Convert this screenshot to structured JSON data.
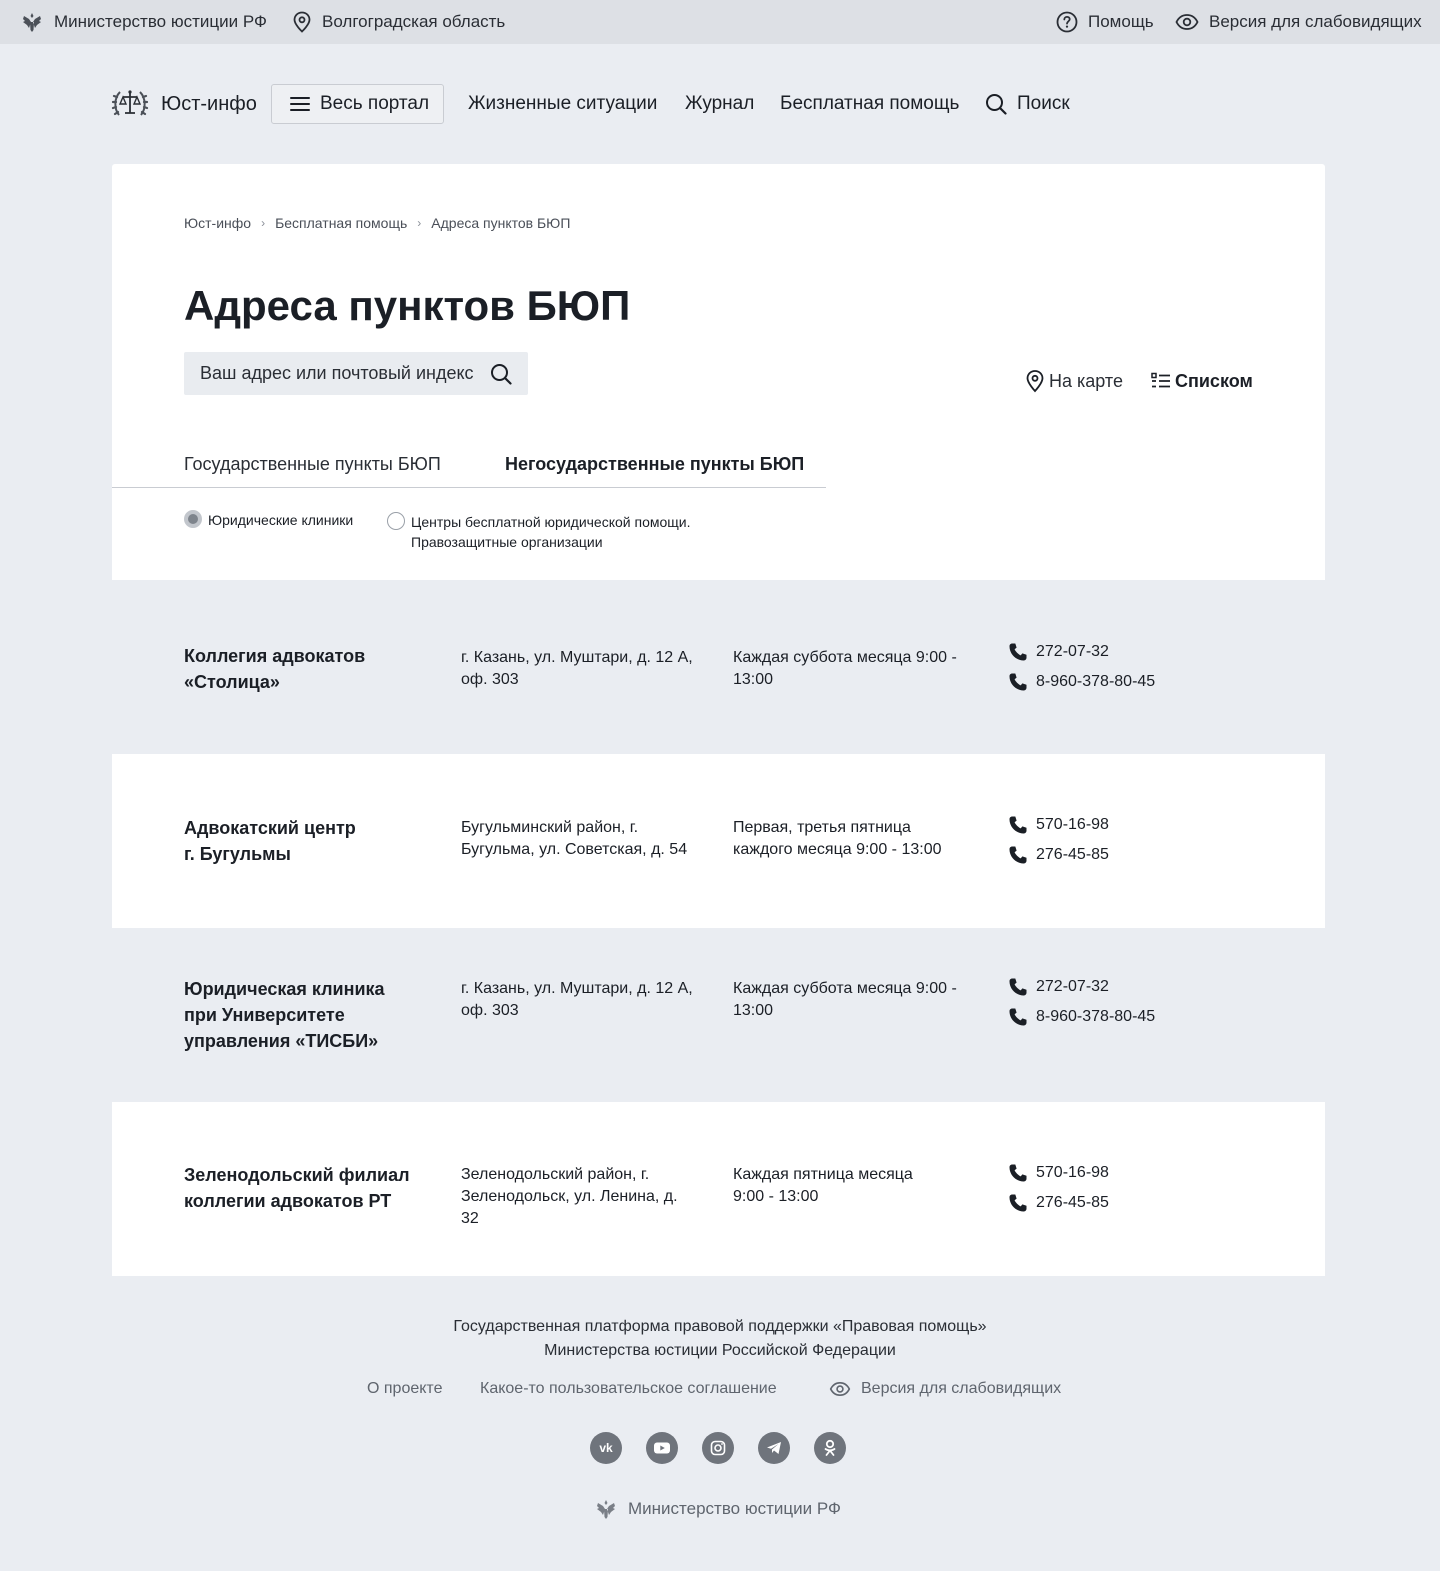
{
  "topbar": {
    "ministry": "Министерство юстиции РФ",
    "region": "Волгоградская область",
    "help": "Помощь",
    "accessibility": "Версия для слабовидящих"
  },
  "nav": {
    "logo_text": "Юст-инфо",
    "portal_button": "Весь портал",
    "links": [
      "Жизненные ситуации",
      "Журнал",
      "Бесплатная помощь"
    ],
    "search": "Поиск"
  },
  "breadcrumb": [
    "Юст-инфо",
    "Бесплатная помощь",
    "Адреса пунктов БЮП"
  ],
  "page": {
    "title": "Адреса пунктов БЮП",
    "search_placeholder": "Ваш адрес или почтовый индекс",
    "view_map": "На карте",
    "view_list": "Списком",
    "active_view": "Списком"
  },
  "tabs": {
    "items": [
      "Государственные пункты БЮП",
      "Негосударственные пункты БЮП"
    ],
    "active": "Негосударственные пункты БЮП"
  },
  "filters": {
    "options": [
      "Юридические клиники",
      "Центры бесплатной юридической помощи. Правозащитные организации"
    ],
    "option2_line1": "Центры бесплатной юридической помощи.",
    "option2_line2": "Правозащитные организации",
    "selected": "Юридические клиники"
  },
  "results": [
    {
      "name_line1": "Коллегия адвокатов",
      "name_line2": "«Столица»",
      "address_line1": "г. Казань, ул. Муштари, д. 12 А,",
      "address_line2": "оф. 303",
      "schedule_line1": "Каждая суббота месяца 9:00 -",
      "schedule_line2": "13:00",
      "phones": [
        "272-07-32",
        "8-960-378-80-45"
      ]
    },
    {
      "name_line1": "Адвокатский центр",
      "name_line2": "г. Бугульмы",
      "address_line1": "Бугульминский район, г.",
      "address_line2": "Бугульма, ул. Советская, д. 54",
      "schedule_line1": "Первая, третья пятница",
      "schedule_line2": "каждого месяца 9:00 - 13:00",
      "phones": [
        "570-16-98",
        "276-45-85"
      ]
    },
    {
      "name_line1": "Юридическая клиника",
      "name_line2": "при Университете",
      "name_line3": "управления «ТИСБИ»",
      "address_line1": "г. Казань, ул. Муштари, д. 12 А,",
      "address_line2": "оф. 303",
      "schedule_line1": "Каждая суббота месяца 9:00 -",
      "schedule_line2": "13:00",
      "phones": [
        "272-07-32",
        "8-960-378-80-45"
      ]
    },
    {
      "name_line1": "Зеленодольский филиал",
      "name_line2": "коллегии адвокатов РТ",
      "address_line1": "Зеленодольский район, г.",
      "address_line2": "Зеленодольск, ул. Ленина, д.",
      "address_line3": "32",
      "schedule_line1": "Каждая пятница месяца",
      "schedule_line2": "9:00 - 13:00",
      "phones": [
        "570-16-98",
        "276-45-85"
      ]
    }
  ],
  "footer": {
    "line1": "Государственная платформа правовой поддержки «Правовая помощь»",
    "line2": "Министерства юстиции Российской Федерации",
    "links": [
      "О проекте",
      "Какое-то пользовательское соглашение",
      "Версия для слабовидящих"
    ],
    "socials": [
      "vk-icon",
      "youtube-icon",
      "instagram-icon",
      "telegram-icon",
      "odnoklassniki-icon"
    ],
    "ministry": "Министерство юстиции РФ"
  },
  "colors": {
    "page_bg": "#eaedf2",
    "topbar_bg": "#dde0e5",
    "card_bg": "#ffffff",
    "text": "#1b1f26",
    "muted": "#5f656e",
    "social_bg": "#6f747c"
  }
}
